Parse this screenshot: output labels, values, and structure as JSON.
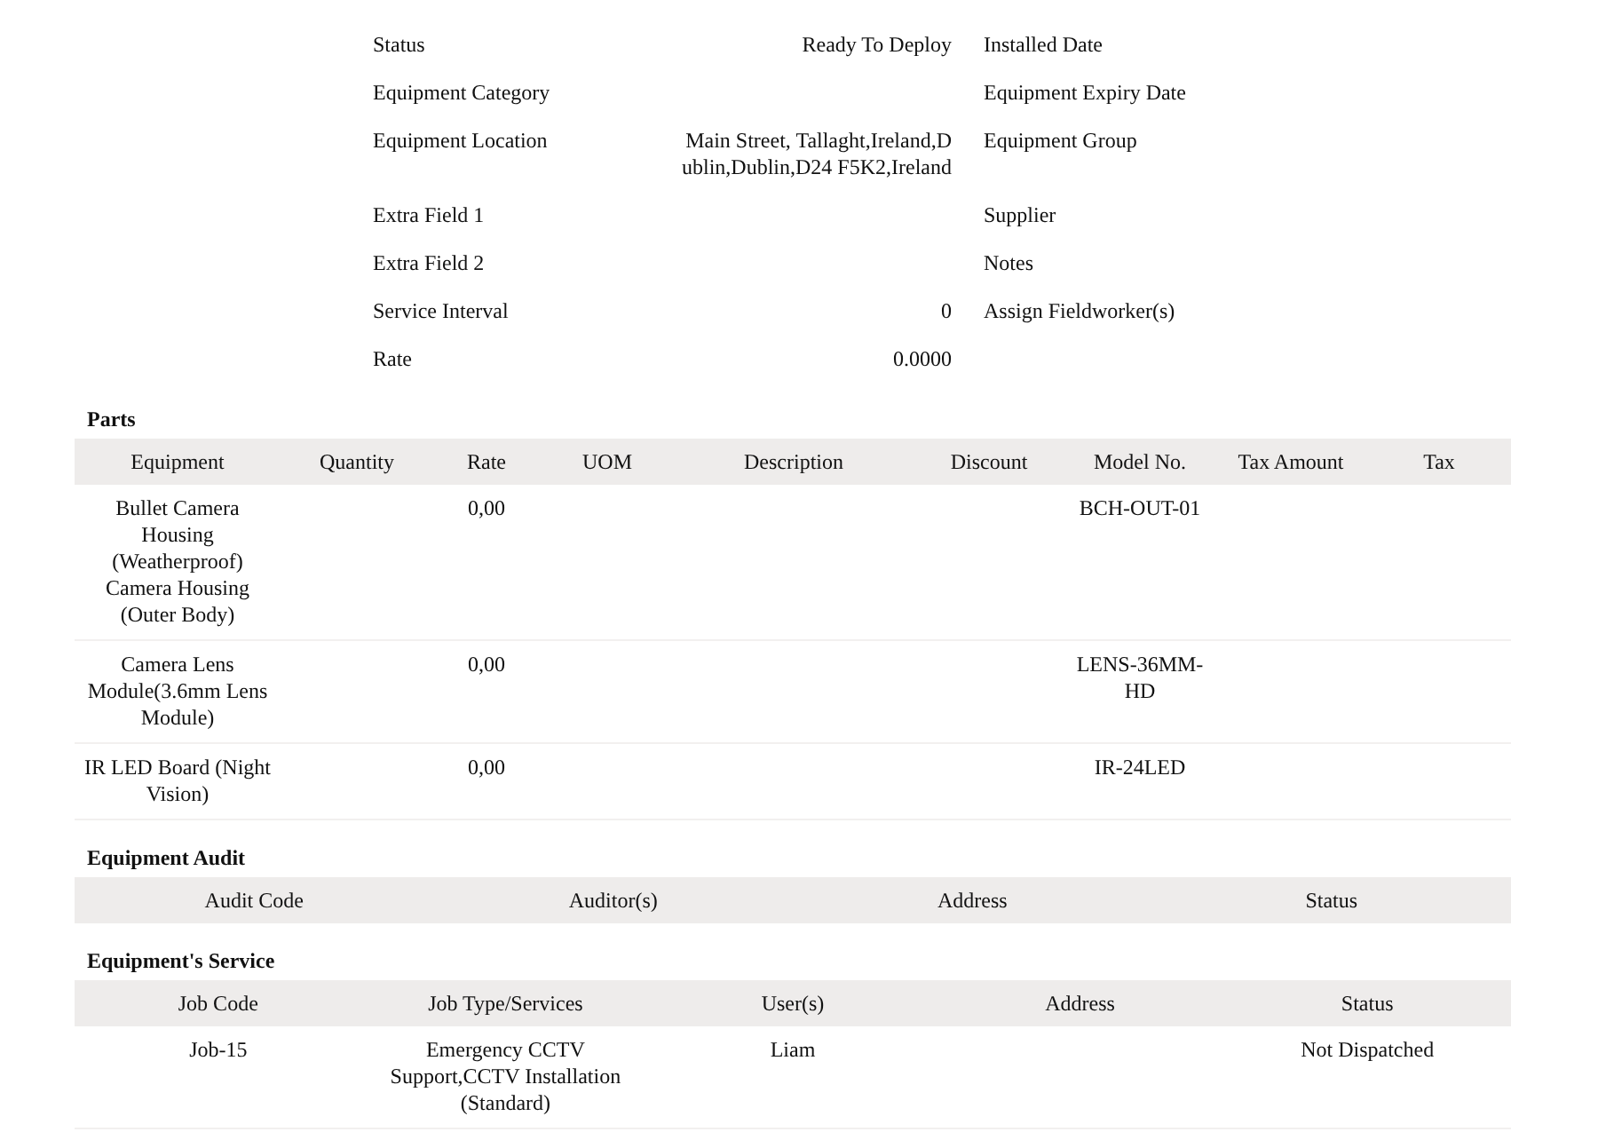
{
  "details": {
    "rows": [
      {
        "label": "Status",
        "value": "Ready To Deploy",
        "right_label": "Installed Date"
      },
      {
        "label": "Equipment Category",
        "right_label": "Equipment Expiry Date"
      },
      {
        "label": "Equipment Location",
        "value": "Main Street, Tallaght,Ireland,Dublin,Dublin,D24 F5K2,Ireland",
        "right_label": "Equipment Group"
      },
      {
        "label": "Extra Field 1",
        "right_label": "Supplier"
      },
      {
        "label": "Extra Field 2",
        "right_label": "Notes"
      },
      {
        "label": "Service Interval",
        "value": "0",
        "right_label": "Assign Fieldworker(s)"
      },
      {
        "label": "Rate",
        "value": "0.0000"
      }
    ]
  },
  "parts": {
    "title": "Parts",
    "columns": [
      "Equipment",
      "Quantity",
      "Rate",
      "UOM",
      "Description",
      "Discount",
      "Model No.",
      "Tax Amount",
      "Tax"
    ],
    "rows": [
      [
        "Bullet Camera Housing (Weatherproof) Camera Housing (Outer Body)",
        null,
        "0,00",
        null,
        null,
        null,
        "BCH-OUT-01",
        null,
        null
      ],
      [
        "Camera Lens Module(3.6mm Lens Module)",
        null,
        "0,00",
        null,
        null,
        null,
        "LENS-36MM-HD",
        null,
        null
      ],
      [
        "IR LED Board (Night Vision)",
        null,
        "0,00",
        null,
        null,
        null,
        "IR-24LED",
        null,
        null
      ]
    ]
  },
  "audit": {
    "title": "Equipment Audit",
    "columns": [
      "Audit Code",
      "Auditor(s)",
      "Address",
      "Status"
    ]
  },
  "service": {
    "title": "Equipment's Service",
    "columns": [
      "Job Code",
      "Job Type/Services",
      "User(s)",
      "Address",
      "Status"
    ],
    "rows": [
      [
        "Job-15",
        "Emergency CCTV Support,CCTV Installation (Standard)",
        "Liam",
        null,
        "Not Dispatched"
      ]
    ]
  }
}
